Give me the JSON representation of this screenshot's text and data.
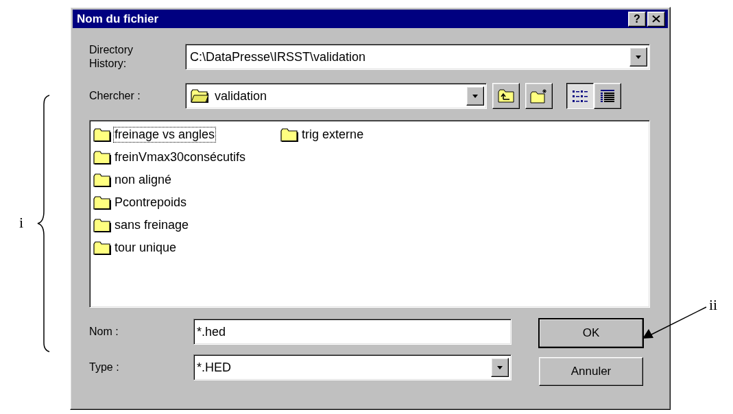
{
  "window": {
    "title": "Nom du fichier",
    "help_button": "?"
  },
  "directory_history": {
    "label": "Directory History:",
    "value": "C:\\DataPresse\\IRSST\\validation"
  },
  "look_in": {
    "label": "Chercher :",
    "value": "validation"
  },
  "toolbar": [
    {
      "kind": "up-folder",
      "selected": false
    },
    {
      "kind": "new-folder",
      "selected": false
    },
    {
      "kind": "list-view",
      "selected": true
    },
    {
      "kind": "details-view",
      "selected": false
    }
  ],
  "files": {
    "columns": [
      [
        {
          "name": "freinage vs angles",
          "selected": true
        },
        {
          "name": "freinVmax30consécutifs",
          "selected": false
        },
        {
          "name": "non aligné",
          "selected": false
        },
        {
          "name": "Pcontrepoids",
          "selected": false
        },
        {
          "name": "sans freinage",
          "selected": false
        },
        {
          "name": "tour unique",
          "selected": false
        }
      ],
      [
        {
          "name": "trig externe",
          "selected": false
        }
      ]
    ]
  },
  "filename": {
    "label": "Nom :",
    "value": "*.hed"
  },
  "filetype": {
    "label": "Type :",
    "value": "*.HED"
  },
  "buttons": [
    {
      "label": "OK",
      "default": true
    },
    {
      "label": "Annuler",
      "default": false
    }
  ],
  "annotations": {
    "brace_label": "i",
    "arrow_label": "ii"
  }
}
